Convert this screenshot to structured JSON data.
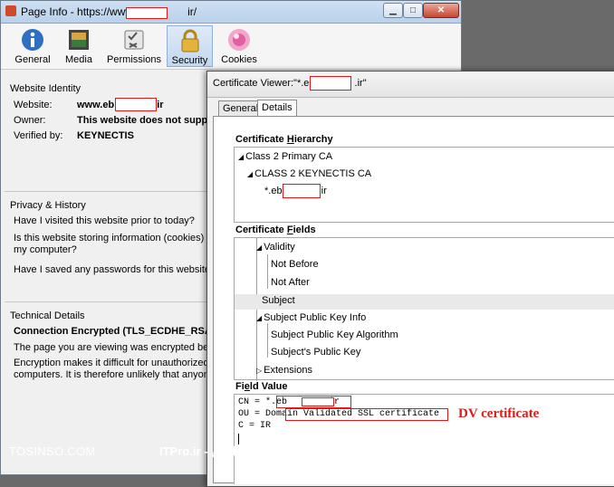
{
  "page_info": {
    "title_prefix": "Page Info - https://www.eb",
    "title_suffix": "ir/",
    "toolbar": [
      {
        "label": "General",
        "icon": "info-icon"
      },
      {
        "label": "Media",
        "icon": "media-icon"
      },
      {
        "label": "Permissions",
        "icon": "permissions-icon"
      },
      {
        "label": "Security",
        "icon": "padlock-icon",
        "selected": true
      },
      {
        "label": "Cookies",
        "icon": "cookie-icon"
      }
    ],
    "identity": {
      "heading": "Website Identity",
      "website_label": "Website:",
      "website_prefix": "www.eb",
      "website_suffix": ".ir",
      "owner_label": "Owner:",
      "owner_value": "This website does not supply",
      "verified_label": "Verified by:",
      "verified_value": "KEYNECTIS"
    },
    "privacy": {
      "heading": "Privacy & History",
      "q1": "Have I visited this website prior to today?",
      "q2a": "Is this website storing information (cookies) o",
      "q2b": "my computer?",
      "q3": "Have I saved any passwords for this website?"
    },
    "technical": {
      "heading": "Technical Details",
      "connection": "Connection Encrypted (TLS_ECDHE_RSA_WI",
      "line1": "The page you are viewing was encrypted befo",
      "line2": "Encryption makes it difficult for unauthorized",
      "line3": "computers. It is therefore unlikely that anyone"
    }
  },
  "cert_viewer": {
    "title_prefix": "Certificate Viewer:\"*.eb",
    "title_suffix": ".ir\"",
    "tabs": [
      "General",
      "Details"
    ],
    "hierarchy_heading": "Certificate Hierarchy",
    "hierarchy": [
      "Class 2 Primary CA",
      "CLASS 2 KEYNECTIS CA"
    ],
    "leaf_prefix": "*.eb",
    "leaf_suffix": ".ir",
    "fields_heading": "Certificate Fields",
    "fields": {
      "validity": "Validity",
      "not_before": "Not Before",
      "not_after": "Not After",
      "subject": "Subject",
      "spki": "Subject Public Key Info",
      "spki_alg": "Subject Public Key Algorithm",
      "spk": "Subject's Public Key",
      "extensions": "Extensions"
    },
    "value_heading": "Field Value",
    "cn_prefix": "CN = *.",
    "cn_value_prefix": "eb",
    "cn_value_suffix": ".ir",
    "ou_prefix": "OU = ",
    "ou_value": "Domain Validated SSL certificate",
    "c_line": "C = IR",
    "annotation": "DV certificate"
  },
  "watermark": {
    "left": "TOSINSO.COM",
    "right": "ITPro.ir - انجمن تخصصی فناوری اطلاعات ایران"
  },
  "colors": {
    "annotation": "#e01818",
    "selected_tab": "#c3d7ef"
  }
}
